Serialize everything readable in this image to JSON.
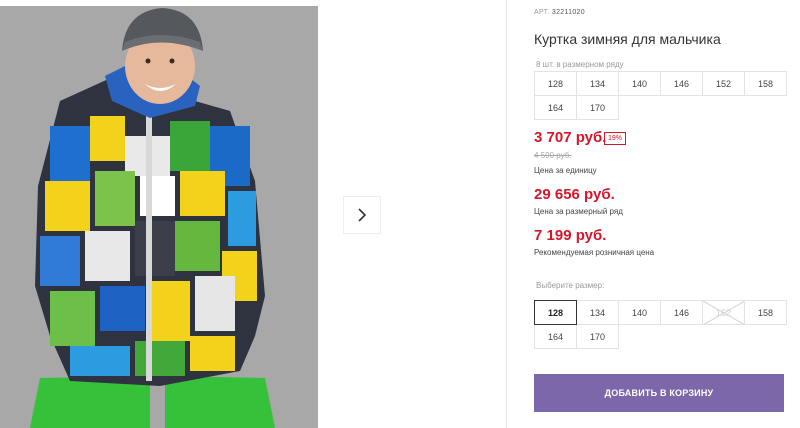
{
  "product": {
    "sku_label": "АРТ.",
    "sku": "32211020",
    "title": "Куртка зимняя для мальчика",
    "row_note": "8 шт. в размерном ряду",
    "row_sizes": [
      "128",
      "134",
      "140",
      "146",
      "152",
      "158",
      "164",
      "170"
    ],
    "price": "3 707 руб.",
    "discount": "19%",
    "old_price": "4 590 руб.",
    "unit_label": "Цена за единицу",
    "row_price": "29 656 руб.",
    "row_price_label": "Цена за размерный ряд",
    "retail_price": "7 199 руб.",
    "retail_label": "Рекомендуемая розничная цена",
    "choose_label": "Выберите размер:",
    "select_sizes": [
      {
        "label": "128",
        "state": "selected"
      },
      {
        "label": "134",
        "state": "available"
      },
      {
        "label": "140",
        "state": "available"
      },
      {
        "label": "146",
        "state": "available"
      },
      {
        "label": "152",
        "state": "unavailable"
      },
      {
        "label": "158",
        "state": "available"
      },
      {
        "label": "164",
        "state": "available"
      },
      {
        "label": "170",
        "state": "available"
      }
    ],
    "cart_button": "ДОБАВИТЬ В КОРЗИНУ"
  },
  "gallery": {
    "next_icon": "chevron-right-icon"
  },
  "colors": {
    "price_red": "#d7152a",
    "button_purple": "#7b67a9"
  }
}
